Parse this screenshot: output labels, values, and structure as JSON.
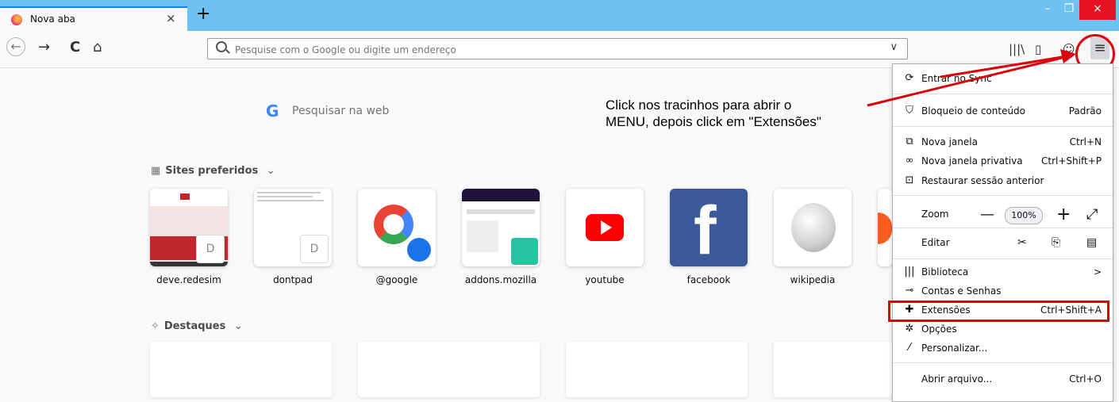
{
  "tab": {
    "title": "Nova aba",
    "close": "×",
    "new_tab": "+"
  },
  "window_controls": {
    "minimize": "–",
    "restore": "❐",
    "close": "×"
  },
  "nav": {
    "back": "←",
    "forward": "→",
    "reload": "C",
    "home": "⌂"
  },
  "urlbar": {
    "placeholder": "Pesquise com o Google ou digite um endereço",
    "dropdown": "∨"
  },
  "toolbar": {
    "library": "|||\\",
    "sidebar": "▯",
    "account": "☺",
    "menu": "≡"
  },
  "search": {
    "g": "G",
    "placeholder": "Pesquisar na web"
  },
  "sites": {
    "title": "Sites preferidos",
    "chevron": "⌄",
    "items": [
      {
        "label": "deve.redesim",
        "badge": "D"
      },
      {
        "label": "dontpad",
        "badge": "D"
      },
      {
        "label": "@google"
      },
      {
        "label": "addons.mozilla"
      },
      {
        "label": "youtube"
      },
      {
        "label": "facebook"
      },
      {
        "label": "wikipedia"
      }
    ]
  },
  "highlights": {
    "title": "Destaques",
    "chevron": "⌄"
  },
  "annotation": {
    "line1": "Click nos tracinhos para abrir o",
    "line2": "MENU, depois click em \"Extensões\""
  },
  "menu": {
    "sync": "Entrar no Sync",
    "content_blocking": "Bloqueio de conteúdo",
    "content_blocking_value": "Padrão",
    "new_window": "Nova janela",
    "new_window_sc": "Ctrl+N",
    "private_window": "Nova janela privativa",
    "private_window_sc": "Ctrl+Shift+P",
    "restore_session": "Restaurar sessão anterior",
    "zoom": "Zoom",
    "zoom_minus": "—",
    "zoom_value": "100%",
    "zoom_plus": "+",
    "zoom_full": "⤢",
    "edit": "Editar",
    "library": "Biblioteca",
    "library_arrow": ">",
    "logins": "Contas e Senhas",
    "addons": "Extensões",
    "addons_sc": "Ctrl+Shift+A",
    "options": "Opções",
    "customize": "Personalizar...",
    "open_file": "Abrir arquivo...",
    "open_file_sc": "Ctrl+O"
  }
}
